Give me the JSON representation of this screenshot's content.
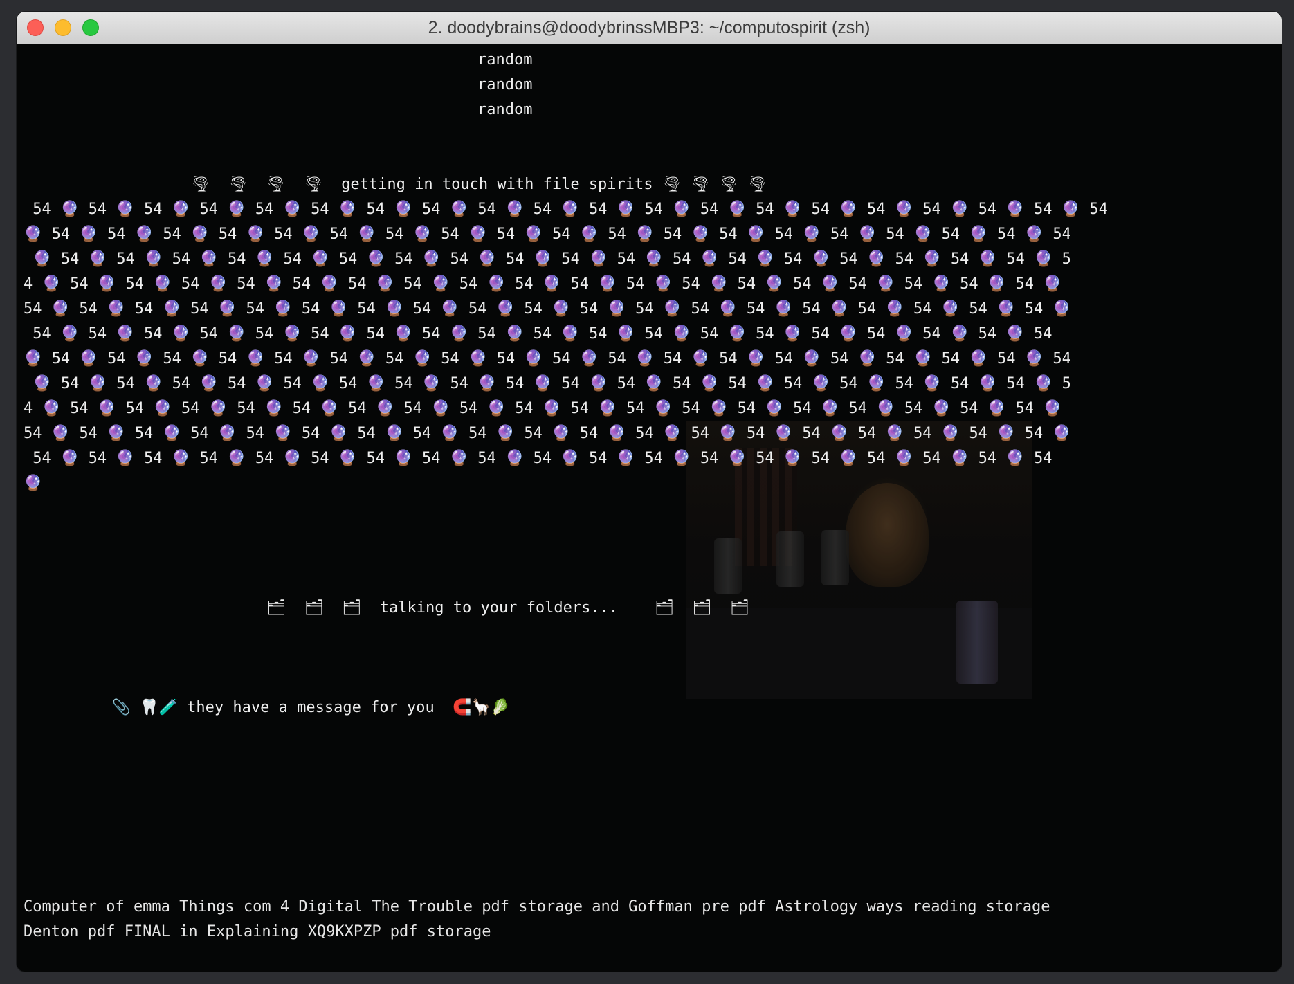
{
  "window": {
    "title": "2. doodybrains@doodybrinssMBP3: ~/computospirit (zsh)"
  },
  "terminal": {
    "random_lines": [
      "random",
      "random",
      "random"
    ],
    "spirits_line": {
      "left_icons": "🌪  🌪  🌪  🌪",
      "text": "getting in touch with file spirits",
      "right_icons": "🌪 🌪 🌪 🌪"
    },
    "crystal_grid": [
      " 54 🔮 54 🔮 54 🔮 54 🔮 54 🔮 54 🔮 54 🔮 54 🔮 54 🔮 54 🔮 54 🔮 54 🔮 54 🔮 54 🔮 54 🔮 54 🔮 54 🔮 54 🔮 54 🔮 54",
      "🔮 54 🔮 54 🔮 54 🔮 54 🔮 54 🔮 54 🔮 54 🔮 54 🔮 54 🔮 54 🔮 54 🔮 54 🔮 54 🔮 54 🔮 54 🔮 54 🔮 54 🔮 54 🔮 54",
      " 🔮 54 🔮 54 🔮 54 🔮 54 🔮 54 🔮 54 🔮 54 🔮 54 🔮 54 🔮 54 🔮 54 🔮 54 🔮 54 🔮 54 🔮 54 🔮 54 🔮 54 🔮 54 🔮 5",
      "4 🔮 54 🔮 54 🔮 54 🔮 54 🔮 54 🔮 54 🔮 54 🔮 54 🔮 54 🔮 54 🔮 54 🔮 54 🔮 54 🔮 54 🔮 54 🔮 54 🔮 54 🔮 54 🔮",
      "54 🔮 54 🔮 54 🔮 54 🔮 54 🔮 54 🔮 54 🔮 54 🔮 54 🔮 54 🔮 54 🔮 54 🔮 54 🔮 54 🔮 54 🔮 54 🔮 54 🔮 54 🔮 54 🔮",
      " 54 🔮 54 🔮 54 🔮 54 🔮 54 🔮 54 🔮 54 🔮 54 🔮 54 🔮 54 🔮 54 🔮 54 🔮 54 🔮 54 🔮 54 🔮 54 🔮 54 🔮 54 🔮 54",
      "🔮 54 🔮 54 🔮 54 🔮 54 🔮 54 🔮 54 🔮 54 🔮 54 🔮 54 🔮 54 🔮 54 🔮 54 🔮 54 🔮 54 🔮 54 🔮 54 🔮 54 🔮 54 🔮 54",
      " 🔮 54 🔮 54 🔮 54 🔮 54 🔮 54 🔮 54 🔮 54 🔮 54 🔮 54 🔮 54 🔮 54 🔮 54 🔮 54 🔮 54 🔮 54 🔮 54 🔮 54 🔮 54 🔮 5",
      "4 🔮 54 🔮 54 🔮 54 🔮 54 🔮 54 🔮 54 🔮 54 🔮 54 🔮 54 🔮 54 🔮 54 🔮 54 🔮 54 🔮 54 🔮 54 🔮 54 🔮 54 🔮 54 🔮",
      "54 🔮 54 🔮 54 🔮 54 🔮 54 🔮 54 🔮 54 🔮 54 🔮 54 🔮 54 🔮 54 🔮 54 🔮 54 🔮 54 🔮 54 🔮 54 🔮 54 🔮 54 🔮 54 🔮",
      " 54 🔮 54 🔮 54 🔮 54 🔮 54 🔮 54 🔮 54 🔮 54 🔮 54 🔮 54 🔮 54 🔮 54 🔮 54 🔮 54 🔮 54 🔮 54 🔮 54 🔮 54 🔮 54",
      "🔮"
    ],
    "folders_line": {
      "left_icons": "🗂  🗂  🗂",
      "text": "talking to your folders...",
      "right_icons": "🗂  🗂  🗂"
    },
    "message_line": {
      "left_icons": "📎 🦷🧪",
      "text": "they have a message for you",
      "right_icons": "🧲🦙🥬"
    },
    "bottom_lines": [
      "Computer of emma Things com 4 Digital The Trouble pdf storage and Goffman pre pdf Astrology ways reading storage",
      "Denton pdf FINAL in Explaining XQ9KXPZP pdf storage"
    ]
  }
}
